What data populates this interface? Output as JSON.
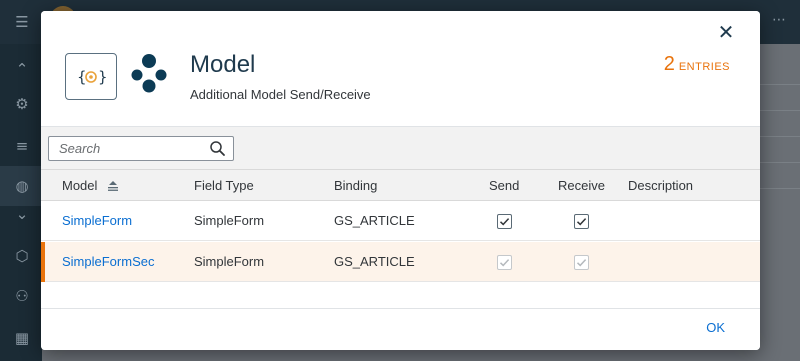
{
  "dialog": {
    "title": "Model",
    "subtitle": "Additional Model Send/Receive",
    "entries_count": "2",
    "entries_label": "ENTRIES",
    "logo_text": "{⊗}",
    "close_symbol": "✕",
    "ok_label": "OK"
  },
  "search": {
    "placeholder": "Search",
    "value": ""
  },
  "table": {
    "columns": [
      "Model",
      "Field Type",
      "Binding",
      "Send",
      "Receive",
      "Description"
    ],
    "rows": [
      {
        "model": "SimpleForm",
        "field_type": "SimpleForm",
        "binding": "GS_ARTICLE",
        "send": true,
        "receive": true,
        "description": "",
        "selected": false
      },
      {
        "model": "SimpleFormSec",
        "field_type": "SimpleForm",
        "binding": "GS_ARTICLE",
        "send": true,
        "receive": true,
        "description": "",
        "selected": true
      }
    ]
  },
  "colors": {
    "accent": "#e9730c",
    "link": "#0a6ed1",
    "title": "#1f3a4d"
  },
  "icons": [
    "hamburger-icon",
    "gear-icon",
    "list-icon",
    "globe-icon",
    "cube-icon",
    "people-icon",
    "grid-icon",
    "close-icon",
    "search-icon",
    "sort-icon",
    "checkmark-icon"
  ]
}
